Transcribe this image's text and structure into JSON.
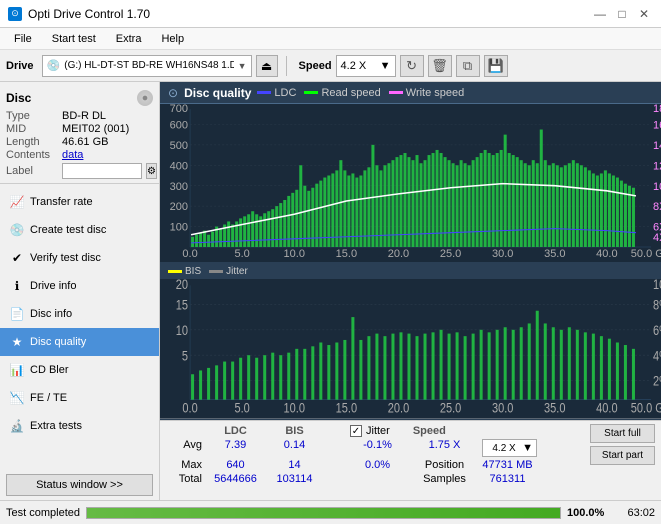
{
  "app": {
    "title": "Opti Drive Control 1.70",
    "icon": "⊙"
  },
  "titlebar": {
    "minimize": "—",
    "maximize": "□",
    "close": "✕"
  },
  "menu": {
    "items": [
      "File",
      "Start test",
      "Extra",
      "Help"
    ]
  },
  "toolbar": {
    "drive_label": "Drive",
    "drive_icon": "💿",
    "drive_text": "(G:)  HL-DT-ST BD-RE  WH16NS48 1.D3",
    "speed_label": "Speed",
    "speed_value": "4.2 X"
  },
  "disc": {
    "header": "Disc",
    "type_label": "Type",
    "type_value": "BD-R DL",
    "mid_label": "MID",
    "mid_value": "MEIT02 (001)",
    "length_label": "Length",
    "length_value": "46.61 GB",
    "contents_label": "Contents",
    "contents_value": "data",
    "label_label": "Label",
    "label_placeholder": ""
  },
  "nav": {
    "items": [
      {
        "id": "transfer-rate",
        "label": "Transfer rate",
        "icon": "📈"
      },
      {
        "id": "create-test-disc",
        "label": "Create test disc",
        "icon": "💿"
      },
      {
        "id": "verify-test-disc",
        "label": "Verify test disc",
        "icon": "✔"
      },
      {
        "id": "drive-info",
        "label": "Drive info",
        "icon": "ℹ"
      },
      {
        "id": "disc-info",
        "label": "Disc info",
        "icon": "📄"
      },
      {
        "id": "disc-quality",
        "label": "Disc quality",
        "icon": "★",
        "active": true
      },
      {
        "id": "cd-bler",
        "label": "CD Bler",
        "icon": "📊"
      },
      {
        "id": "fe-te",
        "label": "FE / TE",
        "icon": "📉"
      },
      {
        "id": "extra-tests",
        "label": "Extra tests",
        "icon": "🔬"
      }
    ],
    "status_btn": "Status window >>"
  },
  "content": {
    "title": "Disc quality",
    "legend": {
      "ldc_label": "LDC",
      "read_label": "Read speed",
      "write_label": "Write speed",
      "bis_label": "BIS",
      "jitter_label": "Jitter"
    },
    "chart1": {
      "y_max": 700,
      "y_right_max": 18,
      "x_max": 50,
      "x_label": "GB"
    },
    "chart2": {
      "y_max": 20,
      "y_right_max": 10,
      "x_max": 50,
      "x_label": "GB"
    }
  },
  "stats": {
    "columns": [
      "",
      "LDC",
      "BIS",
      "",
      "Jitter",
      "Speed",
      ""
    ],
    "rows": [
      {
        "label": "Avg",
        "ldc": "7.39",
        "bis": "0.14",
        "jitter": "-0.1%",
        "speed_label": "1.75 X"
      },
      {
        "label": "Max",
        "ldc": "640",
        "bis": "14",
        "jitter": "0.0%",
        "speed_label": "Position",
        "speed_val": "47731 MB"
      },
      {
        "label": "Total",
        "ldc": "5644666",
        "bis": "103114",
        "jitter": "",
        "speed_label": "Samples",
        "speed_val": "761311"
      }
    ],
    "jitter_checked": true,
    "jitter_label": "Jitter",
    "speed_dropdown": "4.2 X",
    "btn_start_full": "Start full",
    "btn_start_part": "Start part"
  },
  "statusbar": {
    "text": "Test completed",
    "progress": 100,
    "percent": "100.0%",
    "time": "63:02"
  }
}
